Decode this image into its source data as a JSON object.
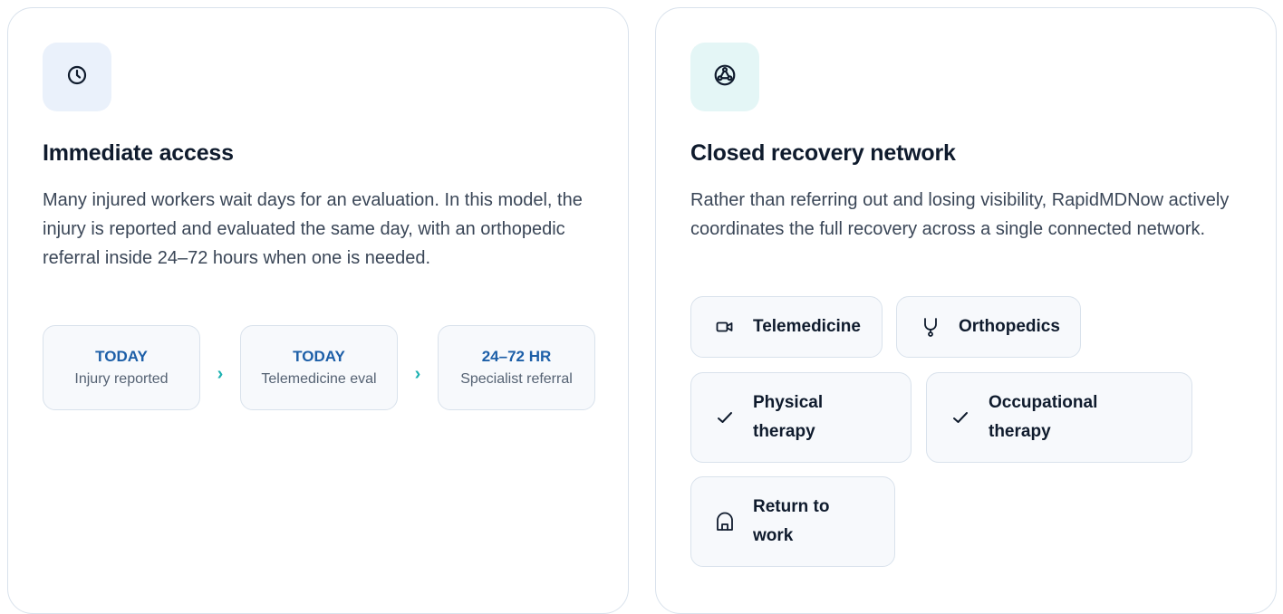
{
  "left_card": {
    "icon": "clock-icon",
    "title": "Immediate access",
    "body": "Many injured workers wait days for an evaluation. In this model, the injury is reported and evaluated the same day, with an orthopedic referral inside 24–72 hours when one is needed.",
    "timeline": [
      {
        "head": "TODAY",
        "sub": "Injury reported"
      },
      {
        "head": "TODAY",
        "sub": "Telemedicine eval"
      },
      {
        "head": "24–72 HR",
        "sub": "Specialist referral"
      }
    ],
    "arrow_glyph": "›"
  },
  "right_card": {
    "icon": "network-icon",
    "title": "Closed recovery network",
    "body": "Rather than referring out and losing visibility, RapidMDNow actively coordinates the full recovery across a single connected network.",
    "services": [
      {
        "icon": "video-icon",
        "label": "Telemedicine"
      },
      {
        "icon": "stethoscope-icon",
        "label": "Orthopedics"
      },
      {
        "icon": "check-icon",
        "label": "Physical therapy"
      },
      {
        "icon": "check-icon",
        "label": "Occupational therapy"
      },
      {
        "icon": "home-icon",
        "label": "Return to work"
      }
    ]
  },
  "colors": {
    "accent_blue": "#1d5fa8",
    "accent_teal": "#1cb1b1",
    "border": "#d9e2ec"
  }
}
